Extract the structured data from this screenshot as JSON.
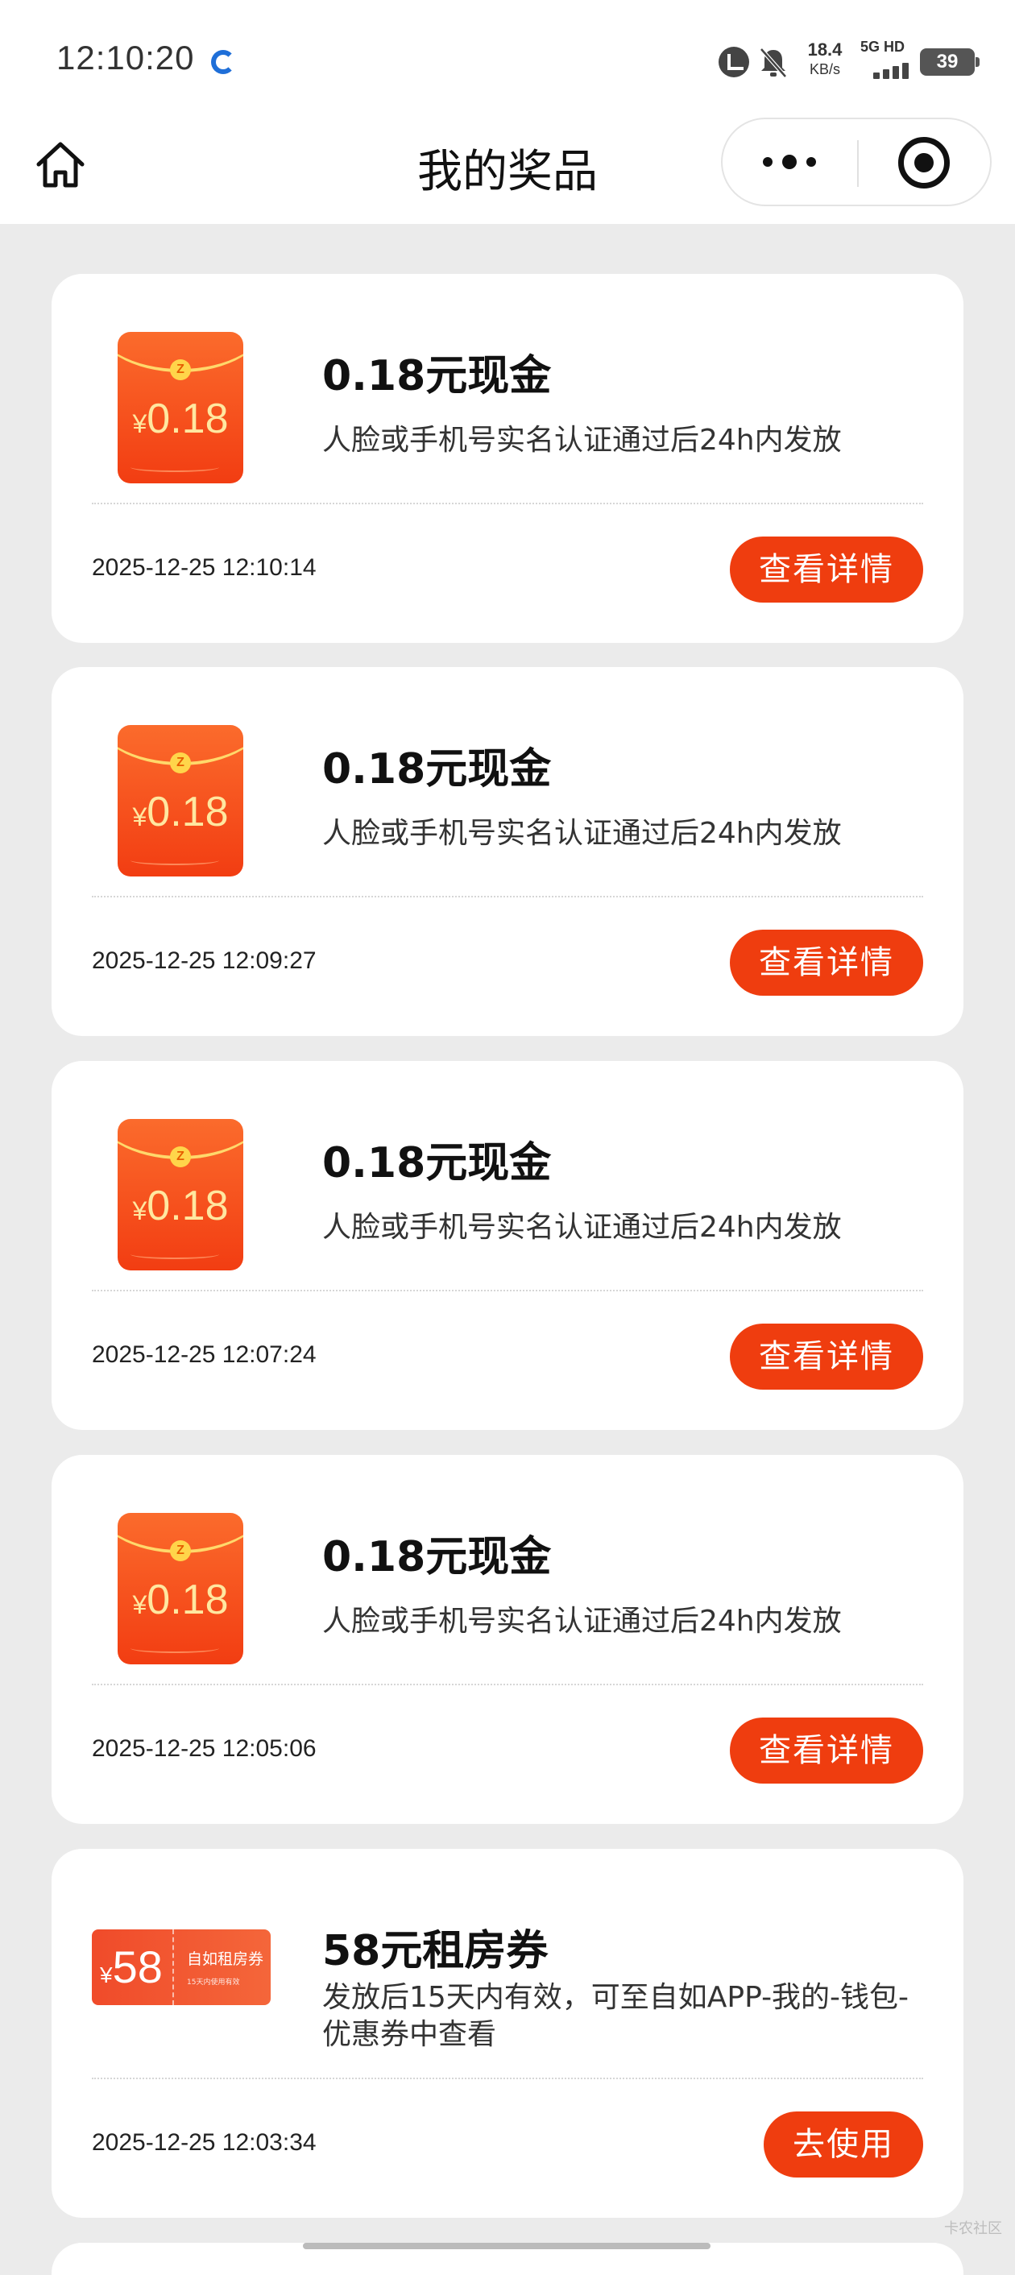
{
  "status_bar": {
    "time": "12:10:20",
    "speed_value": "18.4",
    "speed_unit": "KB/s",
    "network": "5G HD",
    "battery": "39"
  },
  "nav": {
    "title": "我的奖品"
  },
  "prizes": [
    {
      "title": "0.18元现金",
      "description": "人脸或手机号实名认证通过后24h内发放",
      "time": "2025-12-25 12:10:14",
      "button": "查看详情",
      "icon": "red-envelope",
      "icon_amount": "0.18",
      "icon_currency": "¥",
      "icon_coin": "Z"
    },
    {
      "title": "0.18元现金",
      "description": "人脸或手机号实名认证通过后24h内发放",
      "time": "2025-12-25 12:09:27",
      "button": "查看详情",
      "icon": "red-envelope",
      "icon_amount": "0.18",
      "icon_currency": "¥",
      "icon_coin": "Z"
    },
    {
      "title": "0.18元现金",
      "description": "人脸或手机号实名认证通过后24h内发放",
      "time": "2025-12-25 12:07:24",
      "button": "查看详情",
      "icon": "red-envelope",
      "icon_amount": "0.18",
      "icon_currency": "¥",
      "icon_coin": "Z"
    },
    {
      "title": "0.18元现金",
      "description": "人脸或手机号实名认证通过后24h内发放",
      "time": "2025-12-25 12:05:06",
      "button": "查看详情",
      "icon": "red-envelope",
      "icon_amount": "0.18",
      "icon_currency": "¥",
      "icon_coin": "Z"
    },
    {
      "title": "58元租房券",
      "description": "发放后15天内有效，可至自如APP-我的-钱包-优惠券中查看",
      "time": "2025-12-25 12:03:34",
      "button": "去使用",
      "icon": "coupon",
      "icon_amount": "58",
      "icon_currency": "¥",
      "icon_name": "自如租房券",
      "icon_sub": "15天内使用有效"
    }
  ],
  "watermark": "卡农社区",
  "colors": {
    "accent": "#ef3d0f",
    "background": "#ebebeb",
    "card": "#ffffff"
  }
}
